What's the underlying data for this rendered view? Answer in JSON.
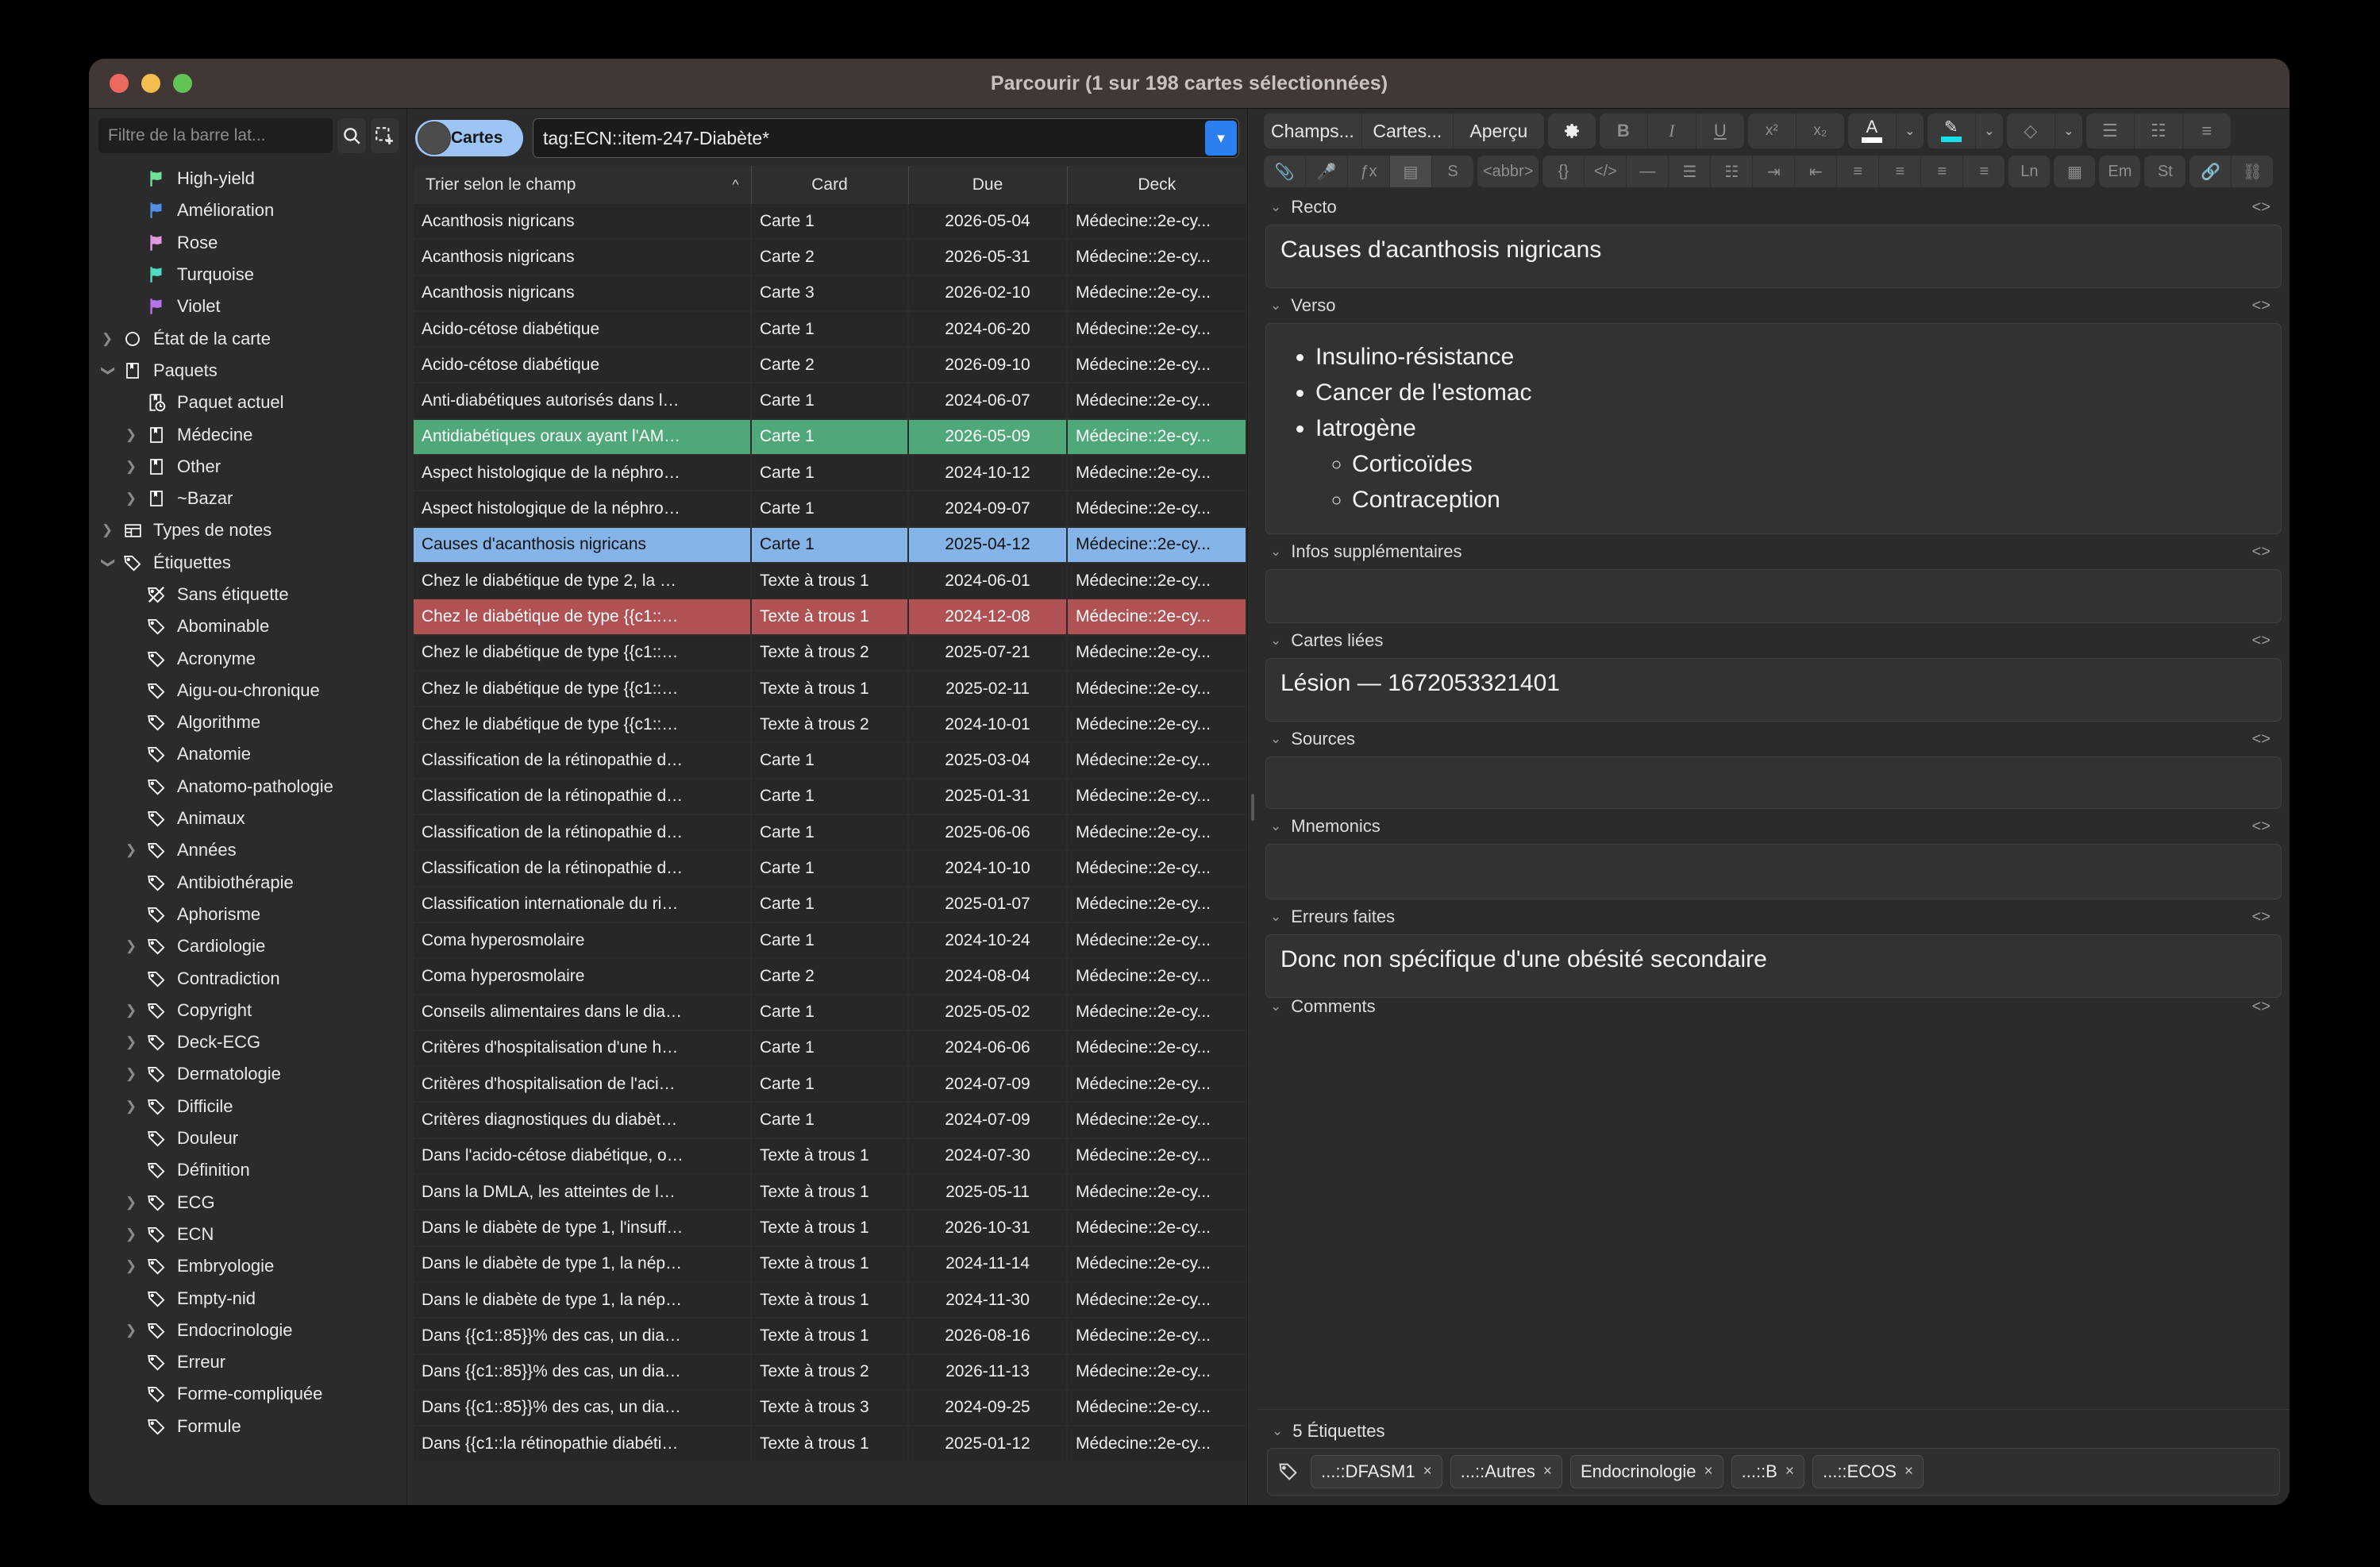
{
  "window": {
    "title": "Parcourir (1 sur 198 cartes sélectionnées)"
  },
  "sidebar": {
    "filter_placeholder": "Filtre de la barre lat...",
    "search_icon": "search-icon",
    "select_icon": "selection-icon",
    "items": [
      {
        "label": "High-yield",
        "icon": "flag-icon",
        "color": "#6ee09a",
        "indent": 2,
        "twisty": ""
      },
      {
        "label": "Amélioration",
        "icon": "flag-icon",
        "color": "#4f8fe8",
        "indent": 2,
        "twisty": ""
      },
      {
        "label": "Rose",
        "icon": "flag-icon",
        "color": "#e39be0",
        "indent": 2,
        "twisty": ""
      },
      {
        "label": "Turquoise",
        "icon": "flag-icon",
        "color": "#4fdcc0",
        "indent": 2,
        "twisty": ""
      },
      {
        "label": "Violet",
        "icon": "flag-icon",
        "color": "#b473e8",
        "indent": 2,
        "twisty": ""
      },
      {
        "label": "État de la carte",
        "icon": "circle-icon",
        "color": "#ffffff",
        "indent": 1,
        "twisty": "right"
      },
      {
        "label": "Paquets",
        "icon": "deck-icon",
        "color": "#ffffff",
        "indent": 1,
        "twisty": "down"
      },
      {
        "label": "Paquet actuel",
        "icon": "deck-clock-icon",
        "color": "#ffffff",
        "indent": 2,
        "twisty": ""
      },
      {
        "label": "Médecine",
        "icon": "deck-icon",
        "color": "#ffffff",
        "indent": 2,
        "twisty": "right"
      },
      {
        "label": "Other",
        "icon": "deck-icon",
        "color": "#ffffff",
        "indent": 2,
        "twisty": "right"
      },
      {
        "label": "~Bazar",
        "icon": "deck-icon",
        "color": "#ffffff",
        "indent": 2,
        "twisty": "right"
      },
      {
        "label": "Types de notes",
        "icon": "notetype-icon",
        "color": "#ffffff",
        "indent": 1,
        "twisty": "right"
      },
      {
        "label": "Étiquettes",
        "icon": "tag-icon",
        "color": "#ffffff",
        "indent": 1,
        "twisty": "down"
      },
      {
        "label": "Sans étiquette",
        "icon": "tag-slash-icon",
        "color": "#ffffff",
        "indent": 2,
        "twisty": ""
      },
      {
        "label": "Abominable",
        "icon": "tag-icon",
        "color": "#ffffff",
        "indent": 2,
        "twisty": ""
      },
      {
        "label": "Acronyme",
        "icon": "tag-icon",
        "color": "#ffffff",
        "indent": 2,
        "twisty": ""
      },
      {
        "label": "Aigu-ou-chronique",
        "icon": "tag-icon",
        "color": "#ffffff",
        "indent": 2,
        "twisty": ""
      },
      {
        "label": "Algorithme",
        "icon": "tag-icon",
        "color": "#ffffff",
        "indent": 2,
        "twisty": ""
      },
      {
        "label": "Anatomie",
        "icon": "tag-icon",
        "color": "#ffffff",
        "indent": 2,
        "twisty": ""
      },
      {
        "label": "Anatomo-pathologie",
        "icon": "tag-icon",
        "color": "#ffffff",
        "indent": 2,
        "twisty": ""
      },
      {
        "label": "Animaux",
        "icon": "tag-icon",
        "color": "#ffffff",
        "indent": 2,
        "twisty": ""
      },
      {
        "label": "Années",
        "icon": "tag-icon",
        "color": "#ffffff",
        "indent": 2,
        "twisty": "right"
      },
      {
        "label": "Antibiothérapie",
        "icon": "tag-icon",
        "color": "#ffffff",
        "indent": 2,
        "twisty": ""
      },
      {
        "label": "Aphorisme",
        "icon": "tag-icon",
        "color": "#ffffff",
        "indent": 2,
        "twisty": ""
      },
      {
        "label": "Cardiologie",
        "icon": "tag-icon",
        "color": "#ffffff",
        "indent": 2,
        "twisty": "right"
      },
      {
        "label": "Contradiction",
        "icon": "tag-icon",
        "color": "#ffffff",
        "indent": 2,
        "twisty": ""
      },
      {
        "label": "Copyright",
        "icon": "tag-icon",
        "color": "#ffffff",
        "indent": 2,
        "twisty": "right"
      },
      {
        "label": "Deck-ECG",
        "icon": "tag-icon",
        "color": "#ffffff",
        "indent": 2,
        "twisty": "right"
      },
      {
        "label": "Dermatologie",
        "icon": "tag-icon",
        "color": "#ffffff",
        "indent": 2,
        "twisty": "right"
      },
      {
        "label": "Difficile",
        "icon": "tag-icon",
        "color": "#ffffff",
        "indent": 2,
        "twisty": "right"
      },
      {
        "label": "Douleur",
        "icon": "tag-icon",
        "color": "#ffffff",
        "indent": 2,
        "twisty": ""
      },
      {
        "label": "Définition",
        "icon": "tag-icon",
        "color": "#ffffff",
        "indent": 2,
        "twisty": ""
      },
      {
        "label": "ECG",
        "icon": "tag-icon",
        "color": "#ffffff",
        "indent": 2,
        "twisty": "right"
      },
      {
        "label": "ECN",
        "icon": "tag-icon",
        "color": "#ffffff",
        "indent": 2,
        "twisty": "right"
      },
      {
        "label": "Embryologie",
        "icon": "tag-icon",
        "color": "#ffffff",
        "indent": 2,
        "twisty": "right"
      },
      {
        "label": "Empty-nid",
        "icon": "tag-icon",
        "color": "#ffffff",
        "indent": 2,
        "twisty": ""
      },
      {
        "label": "Endocrinologie",
        "icon": "tag-icon",
        "color": "#ffffff",
        "indent": 2,
        "twisty": "right"
      },
      {
        "label": "Erreur",
        "icon": "tag-icon",
        "color": "#ffffff",
        "indent": 2,
        "twisty": ""
      },
      {
        "label": "Forme-compliquée",
        "icon": "tag-icon",
        "color": "#ffffff",
        "indent": 2,
        "twisty": ""
      },
      {
        "label": "Formule",
        "icon": "tag-icon",
        "color": "#ffffff",
        "indent": 2,
        "twisty": ""
      }
    ]
  },
  "search": {
    "mode_label": "Cartes",
    "query": "tag:ECN::item-247-Diabète*",
    "dropdown_icon": "chevron-down-icon"
  },
  "table": {
    "columns": [
      "Trier selon le champ",
      "Card",
      "Due",
      "Deck"
    ],
    "sort_indicator": "^",
    "rows": [
      {
        "sort": "Acanthosis nigricans",
        "card": "Carte 1",
        "due": "2026-05-04",
        "deck": "Médecine::2e-cy...",
        "state": "normal"
      },
      {
        "sort": "Acanthosis nigricans",
        "card": "Carte 2",
        "due": "2026-05-31",
        "deck": "Médecine::2e-cy...",
        "state": "alt"
      },
      {
        "sort": "Acanthosis nigricans",
        "card": "Carte 3",
        "due": "2026-02-10",
        "deck": "Médecine::2e-cy...",
        "state": "normal"
      },
      {
        "sort": "Acido-cétose diabétique",
        "card": "Carte 1",
        "due": "2024-06-20",
        "deck": "Médecine::2e-cy...",
        "state": "alt"
      },
      {
        "sort": "Acido-cétose diabétique",
        "card": "Carte 2",
        "due": "2026-09-10",
        "deck": "Médecine::2e-cy...",
        "state": "normal"
      },
      {
        "sort": "Anti-diabétiques autorisés dans l…",
        "card": "Carte 1",
        "due": "2024-06-07",
        "deck": "Médecine::2e-cy...",
        "state": "alt"
      },
      {
        "sort": "Antidiabétiques oraux ayant l'AM…",
        "card": "Carte 1",
        "due": "2026-05-09",
        "deck": "Médecine::2e-cy...",
        "state": "mark-green"
      },
      {
        "sort": "Aspect histologique de la néphro…",
        "card": "Carte 1",
        "due": "2024-10-12",
        "deck": "Médecine::2e-cy...",
        "state": "alt"
      },
      {
        "sort": "Aspect histologique de la néphro…",
        "card": "Carte 1",
        "due": "2024-09-07",
        "deck": "Médecine::2e-cy...",
        "state": "normal"
      },
      {
        "sort": "Causes d'acanthosis nigricans",
        "card": "Carte 1",
        "due": "2025-04-12",
        "deck": "Médecine::2e-cy...",
        "state": "sel"
      },
      {
        "sort": "Chez le diabétique de type 2, la …",
        "card": "Texte à trous 1",
        "due": "2024-06-01",
        "deck": "Médecine::2e-cy...",
        "state": "normal"
      },
      {
        "sort": "Chez le diabétique de type {{c1::…",
        "card": "Texte à trous 1",
        "due": "2024-12-08",
        "deck": "Médecine::2e-cy...",
        "state": "mark-red"
      },
      {
        "sort": "Chez le diabétique de type {{c1::…",
        "card": "Texte à trous 2",
        "due": "2025-07-21",
        "deck": "Médecine::2e-cy...",
        "state": "normal"
      },
      {
        "sort": "Chez le diabétique de type {{c1::…",
        "card": "Texte à trous 1",
        "due": "2025-02-11",
        "deck": "Médecine::2e-cy...",
        "state": "alt"
      },
      {
        "sort": "Chez le diabétique de type {{c1::…",
        "card": "Texte à trous 2",
        "due": "2024-10-01",
        "deck": "Médecine::2e-cy...",
        "state": "normal"
      },
      {
        "sort": "Classification de la rétinopathie d…",
        "card": "Carte 1",
        "due": "2025-03-04",
        "deck": "Médecine::2e-cy...",
        "state": "alt"
      },
      {
        "sort": "Classification de la rétinopathie d…",
        "card": "Carte 1",
        "due": "2025-01-31",
        "deck": "Médecine::2e-cy...",
        "state": "normal"
      },
      {
        "sort": "Classification de la rétinopathie d…",
        "card": "Carte 1",
        "due": "2025-06-06",
        "deck": "Médecine::2e-cy...",
        "state": "alt"
      },
      {
        "sort": "Classification de la rétinopathie d…",
        "card": "Carte 1",
        "due": "2024-10-10",
        "deck": "Médecine::2e-cy...",
        "state": "normal"
      },
      {
        "sort": "Classification internationale du ri…",
        "card": "Carte 1",
        "due": "2025-01-07",
        "deck": "Médecine::2e-cy...",
        "state": "alt"
      },
      {
        "sort": "Coma hyperosmolaire",
        "card": "Carte 1",
        "due": "2024-10-24",
        "deck": "Médecine::2e-cy...",
        "state": "normal"
      },
      {
        "sort": "Coma hyperosmolaire",
        "card": "Carte 2",
        "due": "2024-08-04",
        "deck": "Médecine::2e-cy...",
        "state": "alt"
      },
      {
        "sort": "Conseils alimentaires dans le dia…",
        "card": "Carte 1",
        "due": "2025-05-02",
        "deck": "Médecine::2e-cy...",
        "state": "normal"
      },
      {
        "sort": "Critères d'hospitalisation d'une h…",
        "card": "Carte 1",
        "due": "2024-06-06",
        "deck": "Médecine::2e-cy...",
        "state": "alt"
      },
      {
        "sort": "Critères d'hospitalisation de l'aci…",
        "card": "Carte 1",
        "due": "2024-07-09",
        "deck": "Médecine::2e-cy...",
        "state": "normal"
      },
      {
        "sort": "Critères diagnostiques du diabèt…",
        "card": "Carte 1",
        "due": "2024-07-09",
        "deck": "Médecine::2e-cy...",
        "state": "alt"
      },
      {
        "sort": "Dans l'acido-cétose diabétique, o…",
        "card": "Texte à trous 1",
        "due": "2024-07-30",
        "deck": "Médecine::2e-cy...",
        "state": "normal"
      },
      {
        "sort": "Dans la DMLA, les atteintes de l…",
        "card": "Texte à trous 1",
        "due": "2025-05-11",
        "deck": "Médecine::2e-cy...",
        "state": "alt"
      },
      {
        "sort": "Dans le diabète de type 1, l'insuff…",
        "card": "Texte à trous 1",
        "due": "2026-10-31",
        "deck": "Médecine::2e-cy...",
        "state": "normal"
      },
      {
        "sort": "Dans le diabète de type 1, la nép…",
        "card": "Texte à trous 1",
        "due": "2024-11-14",
        "deck": "Médecine::2e-cy...",
        "state": "alt"
      },
      {
        "sort": "Dans le diabète de type 1, la nép…",
        "card": "Texte à trous 1",
        "due": "2024-11-30",
        "deck": "Médecine::2e-cy...",
        "state": "normal"
      },
      {
        "sort": "Dans {{c1::85}}% des cas, un dia…",
        "card": "Texte à trous 1",
        "due": "2026-08-16",
        "deck": "Médecine::2e-cy...",
        "state": "alt"
      },
      {
        "sort": "Dans {{c1::85}}% des cas, un dia…",
        "card": "Texte à trous 2",
        "due": "2026-11-13",
        "deck": "Médecine::2e-cy...",
        "state": "normal"
      },
      {
        "sort": "Dans {{c1::85}}% des cas, un dia…",
        "card": "Texte à trous 3",
        "due": "2024-09-25",
        "deck": "Médecine::2e-cy...",
        "state": "alt"
      },
      {
        "sort": "Dans {{c1::la rétinopathie diabéti…",
        "card": "Texte à trous 1",
        "due": "2025-01-12",
        "deck": "Médecine::2e-cy...",
        "state": "normal"
      }
    ]
  },
  "editor": {
    "toolbar_row1": [
      {
        "label": "Champs...",
        "name": "fields-button",
        "kind": "wide"
      },
      {
        "label": "Cartes...",
        "name": "cards-button",
        "kind": "wide"
      },
      {
        "label": "Aperçu",
        "name": "preview-button",
        "kind": "wide"
      },
      {
        "label": "⚙",
        "name": "gear-icon",
        "kind": "icon"
      },
      {
        "label": "B",
        "name": "bold-button",
        "kind": "dim-bold"
      },
      {
        "label": "I",
        "name": "italic-button",
        "kind": "dim-italic"
      },
      {
        "label": "U",
        "name": "underline-button",
        "kind": "dim-underline"
      },
      {
        "label": "x²",
        "name": "superscript-button",
        "kind": "dim"
      },
      {
        "label": "x₂",
        "name": "subscript-button",
        "kind": "dim"
      },
      {
        "label": "A",
        "name": "text-color-button",
        "kind": "color-white"
      },
      {
        "label": "⌄",
        "name": "text-color-chevron-icon",
        "kind": "caret"
      },
      {
        "label": "✎",
        "name": "highlight-color-button",
        "kind": "color-cyan"
      },
      {
        "label": "⌄",
        "name": "highlight-color-chevron-icon",
        "kind": "caret"
      },
      {
        "label": "◇",
        "name": "eraser-icon",
        "kind": "dim"
      },
      {
        "label": "⌄",
        "name": "eraser-chevron-icon",
        "kind": "caret"
      },
      {
        "label": "☰",
        "name": "bullet-list-icon",
        "kind": "dim"
      },
      {
        "label": "☷",
        "name": "numbered-list-icon",
        "kind": "dim"
      },
      {
        "label": "≡",
        "name": "list-options-icon",
        "kind": "dim"
      }
    ],
    "toolbar_row2": [
      {
        "label": "📎",
        "name": "attach-icon"
      },
      {
        "label": "🎤",
        "name": "record-icon"
      },
      {
        "label": "ƒx",
        "name": "mathjax-icon"
      },
      {
        "label": "▤",
        "name": "image-occlusion-icon"
      },
      {
        "label": "S",
        "name": "special-chars-icon"
      },
      {
        "label": "<abbr>",
        "name": "abbr-icon"
      },
      {
        "label": "{}",
        "name": "braces-icon"
      },
      {
        "label": "</>",
        "name": "html-icon"
      },
      {
        "label": "—",
        "name": "horizontal-rule-icon"
      },
      {
        "label": "☰",
        "name": "unordered-list-icon"
      },
      {
        "label": "☷",
        "name": "ordered-list-icon"
      },
      {
        "label": "⇥",
        "name": "indent-icon"
      },
      {
        "label": "⇤",
        "name": "outdent-icon"
      },
      {
        "label": "≡",
        "name": "align-justify-icon"
      },
      {
        "label": "≡",
        "name": "align-left-icon"
      },
      {
        "label": "≡",
        "name": "align-right-icon"
      },
      {
        "label": "≡",
        "name": "align-center-icon"
      },
      {
        "label": "Ln",
        "name": "line-icon"
      },
      {
        "label": "▦",
        "name": "table-icon"
      },
      {
        "label": "Em",
        "name": "emphasis-icon"
      },
      {
        "label": "St",
        "name": "strong-icon"
      },
      {
        "label": "🔗",
        "name": "link-icon"
      },
      {
        "label": "⛓",
        "name": "unlink-icon"
      }
    ],
    "fields": [
      {
        "name": "Recto",
        "html_label": "<>",
        "type": "text",
        "value": "Causes d'acanthosis nigricans"
      },
      {
        "name": "Verso",
        "html_label": "<>",
        "type": "list",
        "items": [
          {
            "text": "Insulino-résistance",
            "children": []
          },
          {
            "text": "Cancer de l'estomac",
            "children": []
          },
          {
            "text": "Iatrogène",
            "children": [
              "Corticoïdes",
              "Contraception"
            ]
          }
        ]
      },
      {
        "name": "Infos supplémentaires",
        "html_label": "<>",
        "type": "empty",
        "value": ""
      },
      {
        "name": "Cartes liées",
        "html_label": "<>",
        "type": "text",
        "value": "Lésion — 1672053321401"
      },
      {
        "name": "Sources",
        "html_label": "<>",
        "type": "empty",
        "value": ""
      },
      {
        "name": "Mnemonics",
        "html_label": "<>",
        "type": "empty",
        "value": ""
      },
      {
        "name": "Erreurs faites",
        "html_label": "<>",
        "type": "text",
        "value": "Donc non spécifique d'une obésité secondaire"
      },
      {
        "name": "Comments",
        "html_label": "<>",
        "type": "cut",
        "value": ""
      }
    ]
  },
  "tags": {
    "header": "5 Étiquettes",
    "chips": [
      {
        "label": "...::DFASM1",
        "remove": "×"
      },
      {
        "label": "...::Autres",
        "remove": "×"
      },
      {
        "label": "Endocrinologie",
        "remove": "×"
      },
      {
        "label": "...::B",
        "remove": "×"
      },
      {
        "label": "...::ECOS",
        "remove": "×"
      }
    ]
  },
  "colors": {
    "selected_row": "#84b4e8",
    "marked_green": "#4fa878",
    "marked_red": "#b05153",
    "accent_blue": "#2b7ff0",
    "toggle_on": "#9cc5f5"
  }
}
